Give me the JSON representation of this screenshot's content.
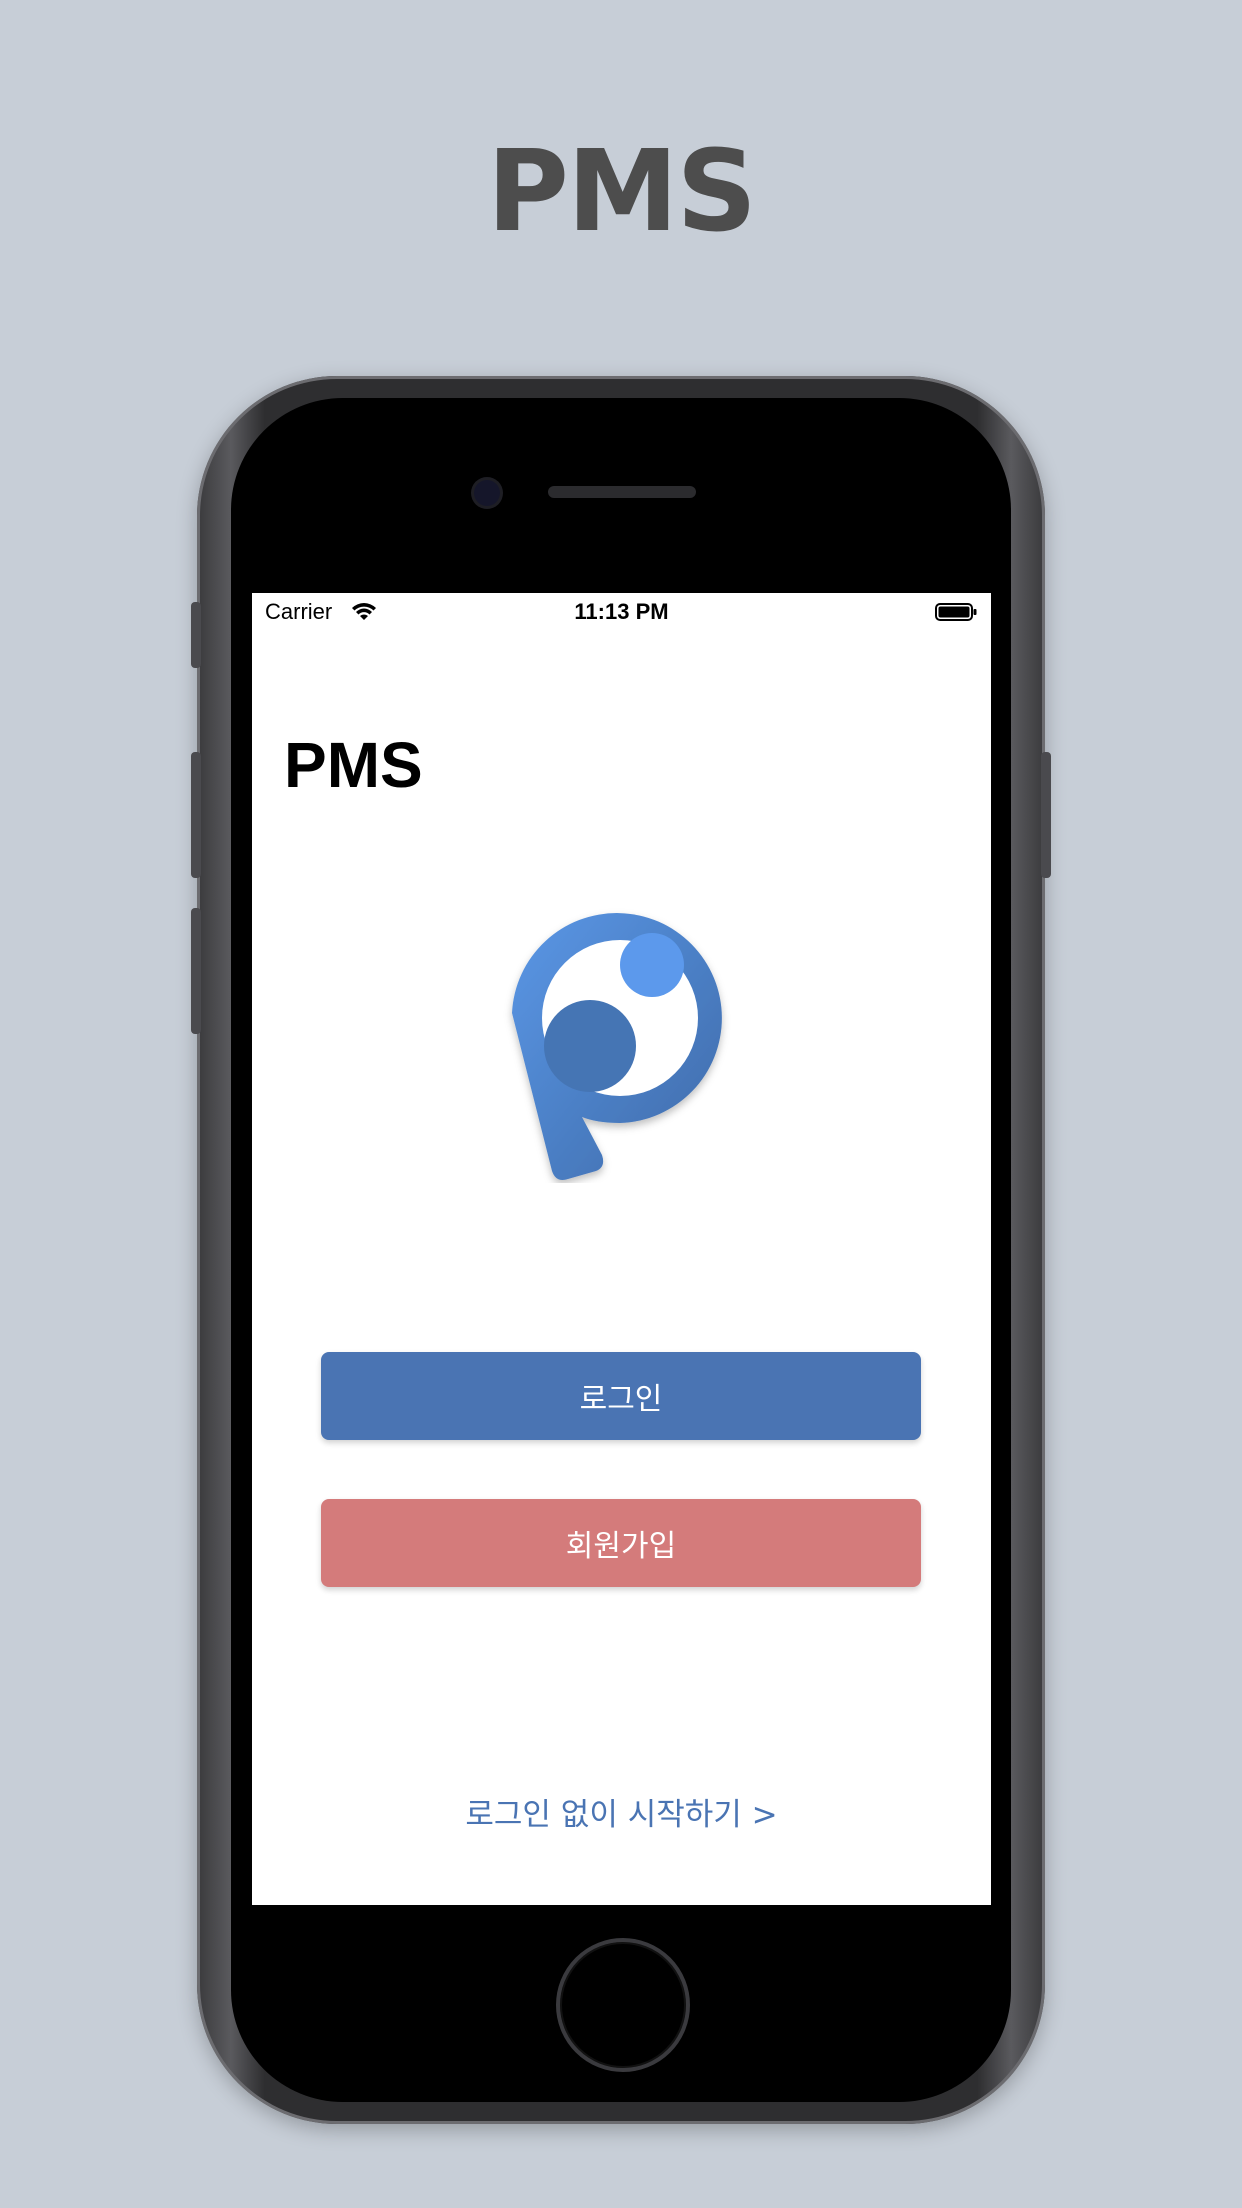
{
  "promo": {
    "title": "PMS"
  },
  "status_bar": {
    "carrier": "Carrier",
    "time": "11:13 PM"
  },
  "screen": {
    "title": "PMS",
    "login_label": "로그인",
    "signup_label": "회원가입",
    "skip_label": "로그인 없이 시작하기 >"
  },
  "colors": {
    "background": "#c7ced7",
    "primary": "#4a74b3",
    "signup": "#d47b7b",
    "promo_text": "#4d4d4d"
  },
  "icons": {
    "wifi": "wifi-icon",
    "battery": "battery-icon",
    "logo": "app-logo-icon"
  }
}
